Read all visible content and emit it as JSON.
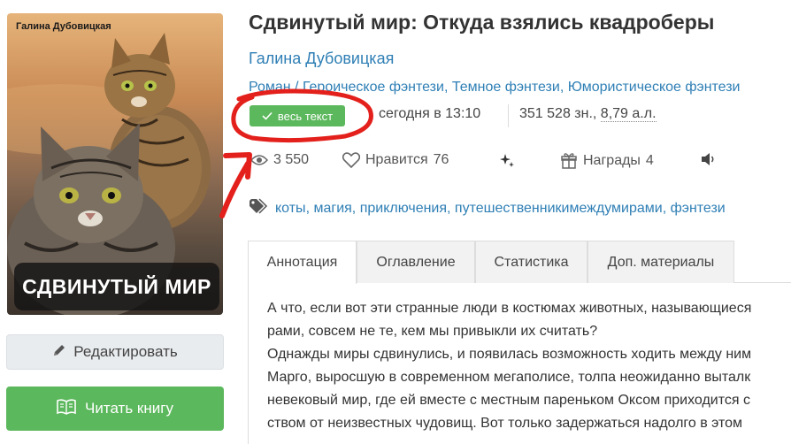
{
  "cover": {
    "author": "Галина Дубовицкая",
    "title": "СДВИНУТЫЙ МИР"
  },
  "buttons": {
    "edit": "Редактировать",
    "read": "Читать книгу"
  },
  "book": {
    "title": "Сдвинутый мир: Откуда взялись квадроберы",
    "author": "Галина Дубовицкая",
    "genres": [
      "Роман / Героическое фэнтези",
      "Темное фэнтези",
      "Юмористическое фэнтези"
    ],
    "status": "весь текст",
    "updated": "сегодня в 13:10",
    "size_chars": "351 528 зн.,",
    "size_al": "8,79 а.л."
  },
  "stats": {
    "views": "3 550",
    "likes_label": "Нравится",
    "likes_count": "76",
    "awards_label": "Награды",
    "awards_count": "4"
  },
  "tags": [
    "коты",
    "магия",
    "приключения",
    "путешественникимеждумирами",
    "фэнтези"
  ],
  "tabs": [
    "Аннотация",
    "Оглавление",
    "Статистика",
    "Доп. материалы"
  ],
  "annotation": [
    "А что, если вот эти странные люди в костюмах животных, называющиеся",
    "рами, совсем не те, кем мы привыкли их считать?",
    "Однажды миры сдвинулись, и появилась возможность ходить между ним",
    "Марго, выросшую в современном мегаполисе, толпа неожиданно выталк",
    "невековый мир, где ей вместе с местным пареньком Оксом приходится с",
    "ством от неизвестных чудовищ. Вот только задержаться надолго в этом"
  ],
  "colors": {
    "link": "#2f7fb5",
    "green": "#5cb85c",
    "annotation_red": "#e3201b"
  },
  "icons": [
    "pencil-icon",
    "book-open-icon",
    "check-icon",
    "eye-icon",
    "heart-icon",
    "sparkles-icon",
    "gift-icon",
    "speaker-icon",
    "tag-icon"
  ]
}
